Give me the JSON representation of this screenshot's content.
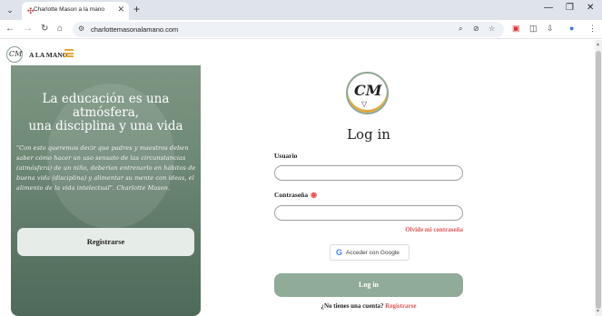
{
  "browser": {
    "tab_title": "Charlotte Mason a la mano",
    "url": "charlottemasonalamano.com",
    "icons": [
      "tab-search-icon",
      "favicon-icon",
      "close-icon",
      "new-tab-icon",
      "minimize-icon",
      "maximize-icon",
      "window-close-icon",
      "back-icon",
      "forward-icon",
      "reload-icon",
      "home-icon",
      "site-info-icon",
      "zoom-icon",
      "eye-off-icon",
      "bookmark-star-icon",
      "extension-icon",
      "sidebar-icon",
      "downloads-icon",
      "profile-avatar-icon",
      "menu-icon"
    ]
  },
  "header": {
    "logo_text": "CM",
    "brand": "A LA MANO"
  },
  "hero": {
    "title_line1": "La educación es una",
    "title_line2": "atmósfera,",
    "title_line3": "una disciplina y una vida",
    "quote": "\"Con esto queremos decir que padres y maestros deben saber cómo hacer un uso sensato de las circunstancias (atmósfera) de un niño, deberían entrenarlo en hábitos de buena vida (disciplina) y alimentar su mente con ideas, el alimento de la vida intelectual\". Charlotte Mason.",
    "register_label": "Registrarse"
  },
  "login": {
    "logo_text": "CM",
    "title": "Log in",
    "username_label": "Usuario",
    "password_label": "Contraseña",
    "username_value": "",
    "password_value": "",
    "forgot_label": "Olvide mi contraseña",
    "google_label": "Acceder con Google",
    "login_button": "Log in",
    "no_account_text": "¿No tienes una cuenta?",
    "register_link": "Registrarse"
  },
  "colors": {
    "accent_green": "#90ab98",
    "accent_red": "#e05454",
    "accent_gold": "#e0a93b"
  }
}
